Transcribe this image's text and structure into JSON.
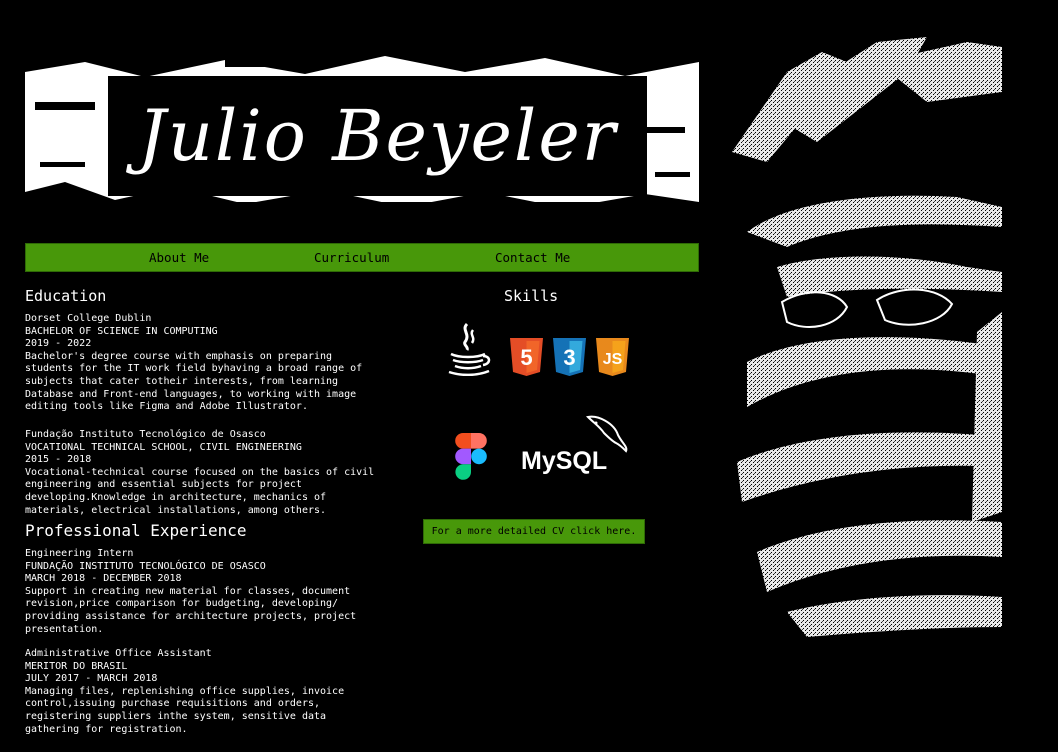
{
  "header": {
    "name": "Julio Beyeler"
  },
  "nav": [
    {
      "label": "About Me"
    },
    {
      "label": "Curriculum"
    },
    {
      "label": "Contact Me"
    }
  ],
  "education": {
    "title": "Education",
    "entries": [
      {
        "school": "Dorset College Dublin",
        "degree": "BACHELOR OF SCIENCE IN COMPUTING",
        "dates": "2019 - 2022",
        "description": "Bachelor's degree course with emphasis on preparing students for the IT work field byhaving a broad range of subjects that cater totheir interests, from learning Database and Front-end languages, to working with image editing tools like Figma and Adobe Illustrator."
      },
      {
        "school": "Fundação Instituto Tecnológico de Osasco",
        "degree": "VOCATIONAL TECHNICAL SCHOOL, CIVIL ENGINEERING",
        "dates": "2015 - 2018",
        "description": "Vocational-technical course focused on the basics of civil engineering and essential subjects for project developing.Knowledge in architecture, mechanics of materials, electrical installations, among others."
      }
    ]
  },
  "experience": {
    "title": "Professional Experience",
    "entries": [
      {
        "role": "Engineering Intern",
        "company": "FUNDAÇÃO INSTITUTO TECNOLÓGICO DE OSASCO",
        "dates": "MARCH 2018 - DECEMBER 2018",
        "description": "Support in creating new material for classes, document revision,price comparison for budgeting, developing/ providing assistance for architecture projects, project presentation."
      },
      {
        "role": "Administrative Office Assistant",
        "company": "MERITOR DO BRASIL",
        "dates": "JULY 2017 - MARCH 2018",
        "description": "Managing files, replenishing office supplies, invoice control,issuing purchase requisitions and orders, registering suppliers inthe system, sensitive data gathering for registration."
      }
    ]
  },
  "skills": {
    "title": "Skills",
    "icons": [
      "java-icon",
      "html5-icon",
      "css3-icon",
      "javascript-icon",
      "figma-icon",
      "mysql-icon"
    ],
    "html_label": "5",
    "css_label": "3",
    "js_label": "JS",
    "mysql_label": "MySQL",
    "colors": {
      "html": "#e44d26",
      "css": "#1f7bc1",
      "js": "#f0941f",
      "accent": "#48980a"
    }
  },
  "cv_button": {
    "label": "For a more detailed CV click here."
  }
}
